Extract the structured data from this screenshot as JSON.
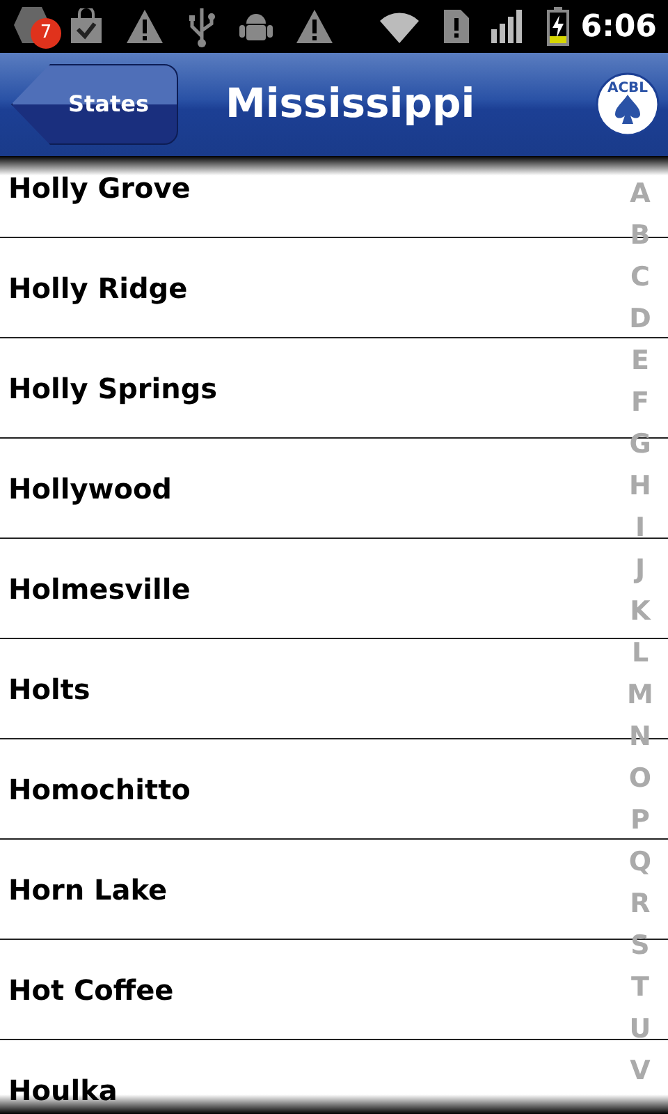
{
  "status_bar": {
    "notification_count": "7",
    "time": "6:06"
  },
  "header": {
    "back_button": "States",
    "title": "Mississippi",
    "logo_text": "ACBL"
  },
  "cities": [
    "Holly Grove",
    "Holly Ridge",
    "Holly Springs",
    "Hollywood",
    "Holmesville",
    "Holts",
    "Homochitto",
    "Horn Lake",
    "Hot Coffee",
    "Houlka"
  ],
  "index_letters": [
    "A",
    "B",
    "C",
    "D",
    "E",
    "F",
    "G",
    "H",
    "I",
    "J",
    "K",
    "L",
    "M",
    "N",
    "O",
    "P",
    "Q",
    "R",
    "S",
    "T",
    "U",
    "V"
  ]
}
